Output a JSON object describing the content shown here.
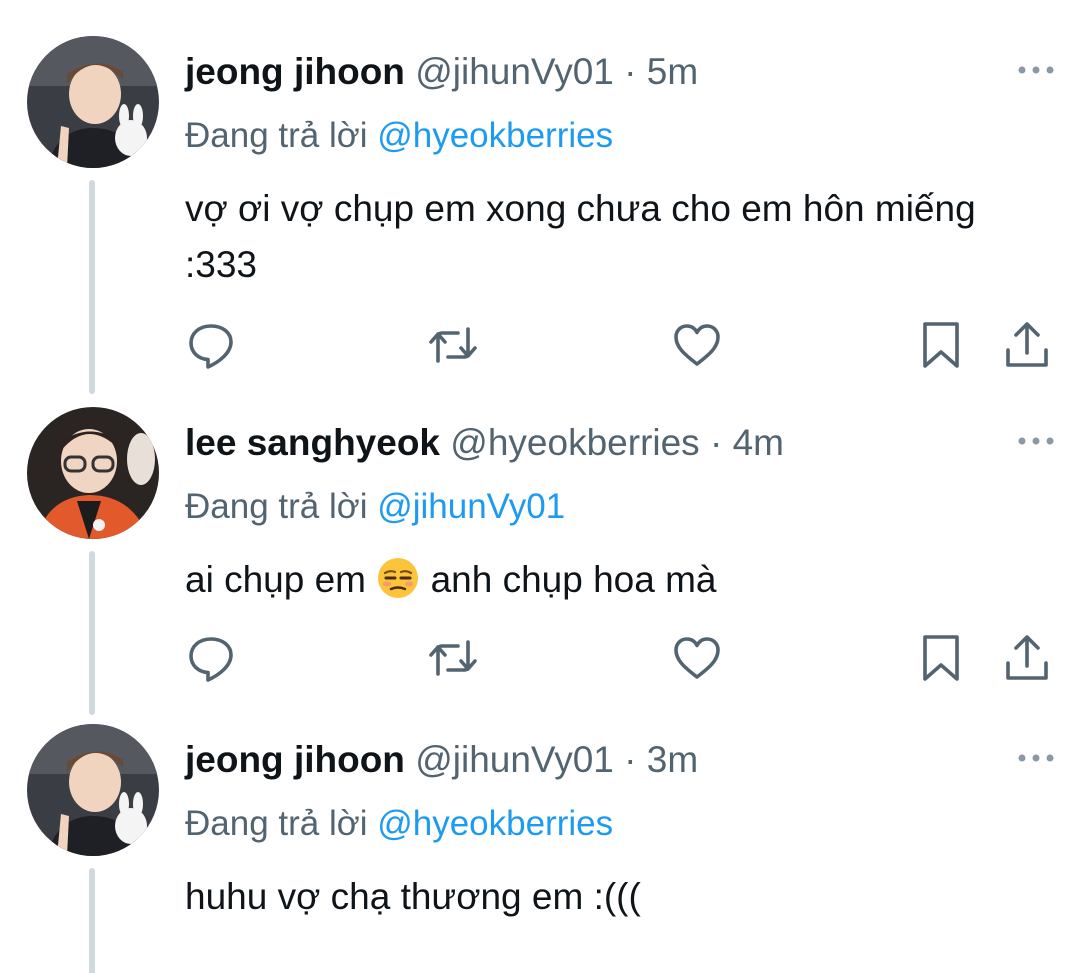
{
  "colors": {
    "text": "#0f1419",
    "muted": "#536471",
    "mention": "#1d9bf0",
    "thread_line": "#cfd9de"
  },
  "reply_prefix": "Đang trả lời",
  "tweets": [
    {
      "author": "jeong jihoon",
      "handle": "@jihunVy01",
      "separator": "·",
      "time": "5m",
      "reply_to": "@hyeokberries",
      "text": "vợ ơi vợ chụp em xong chưa cho em hôn miếng :333",
      "avatar": "jihoon-avatar"
    },
    {
      "author": "lee sanghyeok",
      "handle": "@hyeokberries",
      "separator": "·",
      "time": "4m",
      "reply_to": "@jihunVy01",
      "text_before": "ai chụp em",
      "emoji": "unamused-face-emoji",
      "text_after": "anh chụp hoa mà",
      "avatar": "sanghyeok-avatar"
    },
    {
      "author": "jeong jihoon",
      "handle": "@jihunVy01",
      "separator": "·",
      "time": "3m",
      "reply_to": "@hyeokberries",
      "text": "huhu vợ chạ thương em :(((",
      "avatar": "jihoon-avatar"
    }
  ],
  "actions": [
    "reply-icon",
    "retweet-icon",
    "like-icon",
    "bookmark-icon",
    "share-icon"
  ]
}
